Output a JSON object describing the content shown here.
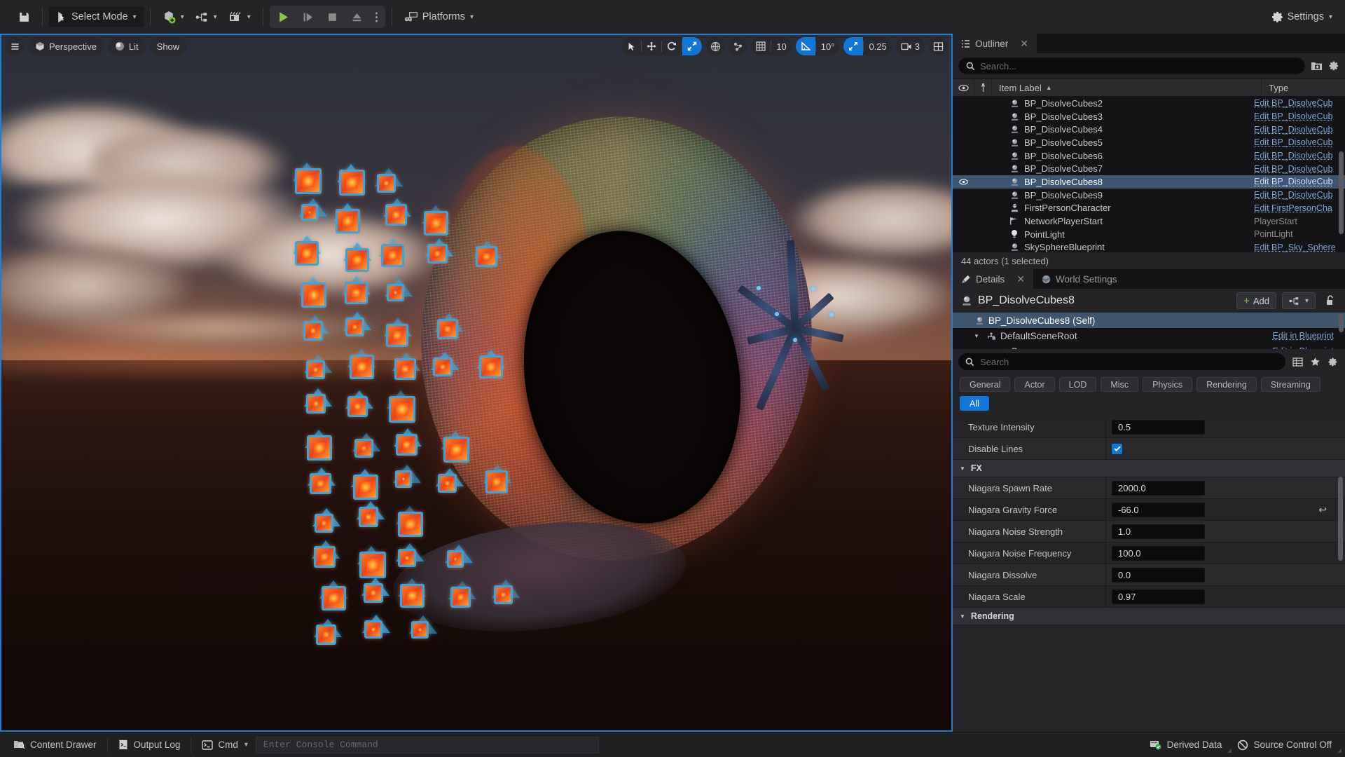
{
  "toolbar": {
    "save_icon": "save-icon",
    "select_mode": "Select Mode",
    "add_actor_icon": "add-actor-icon",
    "blueprints_icon": "blueprints-icon",
    "cinematics_icon": "cinematics-icon",
    "play_icon": "play-icon",
    "skip_icon": "step-icon",
    "stop_icon": "stop-icon",
    "eject_icon": "eject-icon",
    "more_icon": "more-options-icon",
    "platforms": "Platforms",
    "settings": "Settings"
  },
  "viewport": {
    "menu_icon": "viewport-menu-icon",
    "view_type": "Perspective",
    "view_mode": "Lit",
    "show": "Show",
    "tools": {
      "select_icon": "select-arrow-icon",
      "move_icon": "move-gizmo-icon",
      "rotate_icon": "rotate-gizmo-icon",
      "scale_icon": "scale-gizmo-icon",
      "coord_icon": "world-coords-icon",
      "snap_surface_icon": "surface-snap-icon",
      "grid_icon": "grid-snap-icon",
      "grid_value": "10",
      "angle_icon": "angle-snap-icon",
      "angle_value": "10°",
      "scale_snap_icon": "scale-snap-icon",
      "scale_value": "0.25",
      "camera_icon": "camera-speed-icon",
      "camera_value": "3",
      "layout_icon": "viewport-layout-icon"
    }
  },
  "outliner": {
    "tab_label": "Outliner",
    "tab_icon": "outliner-icon",
    "close_icon": "close-icon",
    "search_placeholder": "Search...",
    "search_value": "",
    "search_icon": "search-icon",
    "add_folder_icon": "new-folder-icon",
    "settings_icon": "gear-icon",
    "columns": {
      "eye": "visibility-icon",
      "pin": "pin-icon",
      "label": "Item Label",
      "sort_icon": "sort-ascending-icon",
      "type": "Type"
    },
    "rows": [
      {
        "label": "BP_DisolveCubes2",
        "type": "Edit BP_DisolveCub",
        "icon": "blueprint-actor-icon",
        "link": true,
        "selected": false
      },
      {
        "label": "BP_DisolveCubes3",
        "type": "Edit BP_DisolveCub",
        "icon": "blueprint-actor-icon",
        "link": true,
        "selected": false
      },
      {
        "label": "BP_DisolveCubes4",
        "type": "Edit BP_DisolveCub",
        "icon": "blueprint-actor-icon",
        "link": true,
        "selected": false
      },
      {
        "label": "BP_DisolveCubes5",
        "type": "Edit BP_DisolveCub",
        "icon": "blueprint-actor-icon",
        "link": true,
        "selected": false
      },
      {
        "label": "BP_DisolveCubes6",
        "type": "Edit BP_DisolveCub",
        "icon": "blueprint-actor-icon",
        "link": true,
        "selected": false
      },
      {
        "label": "BP_DisolveCubes7",
        "type": "Edit BP_DisolveCub",
        "icon": "blueprint-actor-icon",
        "link": true,
        "selected": false
      },
      {
        "label": "BP_DisolveCubes8",
        "type": "Edit BP_DisolveCub",
        "icon": "blueprint-actor-icon",
        "link": true,
        "selected": true
      },
      {
        "label": "BP_DisolveCubes9",
        "type": "Edit BP_DisolveCub",
        "icon": "blueprint-actor-icon",
        "link": true,
        "selected": false
      },
      {
        "label": "FirstPersonCharacter",
        "type": "Edit FirstPersonCha",
        "icon": "character-icon",
        "link": true,
        "selected": false
      },
      {
        "label": "NetworkPlayerStart",
        "type": "PlayerStart",
        "icon": "player-start-icon",
        "link": false,
        "selected": false
      },
      {
        "label": "PointLight",
        "type": "PointLight",
        "icon": "point-light-icon",
        "link": false,
        "selected": false
      },
      {
        "label": "SkySphereBlueprint",
        "type": "Edit BP_Sky_Sphere",
        "icon": "blueprint-actor-icon",
        "link": true,
        "selected": false
      }
    ],
    "status": "44 actors (1 selected)"
  },
  "details": {
    "tab_label": "Details",
    "tab_icon": "details-icon",
    "close_icon": "close-icon",
    "world_settings_label": "World Settings",
    "world_settings_icon": "globe-icon",
    "actor_name": "BP_DisolveCubes8",
    "actor_icon": "blueprint-actor-icon",
    "add_label": "Add",
    "add_icon": "plus-icon",
    "blueprint_menu_icon": "blueprint-menu-icon",
    "lock_icon": "unlock-icon",
    "components": [
      {
        "label": "BP_DisolveCubes8 (Self)",
        "link": "",
        "icon": "blueprint-actor-icon",
        "selected": true,
        "indent": 0,
        "expander": ""
      },
      {
        "label": "DefaultSceneRoot",
        "link": "Edit in Blueprint",
        "icon": "scene-root-icon",
        "selected": false,
        "indent": 1,
        "expander": "▼"
      },
      {
        "label": "Box",
        "link": "Edit in Blueprint",
        "icon": "mesh-icon",
        "selected": false,
        "indent": 2,
        "expander": ""
      }
    ],
    "search_placeholder": "Search",
    "search_value": "",
    "search_icon": "search-icon",
    "column_view_icon": "column-view-icon",
    "favorites_icon": "star-icon",
    "settings_icon": "gear-icon",
    "filters": [
      {
        "label": "General",
        "active": false
      },
      {
        "label": "Actor",
        "active": false
      },
      {
        "label": "LOD",
        "active": false
      },
      {
        "label": "Misc",
        "active": false
      },
      {
        "label": "Physics",
        "active": false
      },
      {
        "label": "Rendering",
        "active": false
      },
      {
        "label": "Streaming",
        "active": false
      },
      {
        "label": "All",
        "active": true
      }
    ],
    "properties": [
      {
        "kind": "number",
        "name": "Texture Intensity",
        "value": "0.5",
        "revert": false
      },
      {
        "kind": "checkbox",
        "name": "Disable Lines",
        "value": true,
        "revert": false
      },
      {
        "kind": "category",
        "name": "FX"
      },
      {
        "kind": "number",
        "name": "Niagara Spawn Rate",
        "value": "2000.0",
        "revert": false
      },
      {
        "kind": "number",
        "name": "Niagara Gravity Force",
        "value": "-66.0",
        "revert": true
      },
      {
        "kind": "number",
        "name": "Niagara Noise Strength",
        "value": "1.0",
        "revert": false
      },
      {
        "kind": "number",
        "name": "Niagara Noise Frequency",
        "value": "100.0",
        "revert": false
      },
      {
        "kind": "number",
        "name": "Niagara Dissolve",
        "value": "0.0",
        "revert": false
      },
      {
        "kind": "number",
        "name": "Niagara Scale",
        "value": "0.97",
        "revert": false
      },
      {
        "kind": "category",
        "name": "Rendering"
      }
    ]
  },
  "statusbar": {
    "content_drawer": "Content Drawer",
    "content_drawer_icon": "drawer-icon",
    "output_log": "Output Log",
    "output_log_icon": "log-icon",
    "cmd": "Cmd",
    "cmd_icon": "console-icon",
    "console_placeholder": "Enter Console Command",
    "console_value": "",
    "derived_data": "Derived Data",
    "derived_data_icon": "derived-data-icon",
    "source_control": "Source Control Off",
    "source_control_icon": "source-control-off-icon"
  },
  "colors": {
    "accent_blue": "#1177d6",
    "selection_blue": "#3d556e",
    "link_blue": "#7ea6d8",
    "panel_bg": "#242427",
    "list_bg": "#141416",
    "play_green": "#8bc53f"
  }
}
